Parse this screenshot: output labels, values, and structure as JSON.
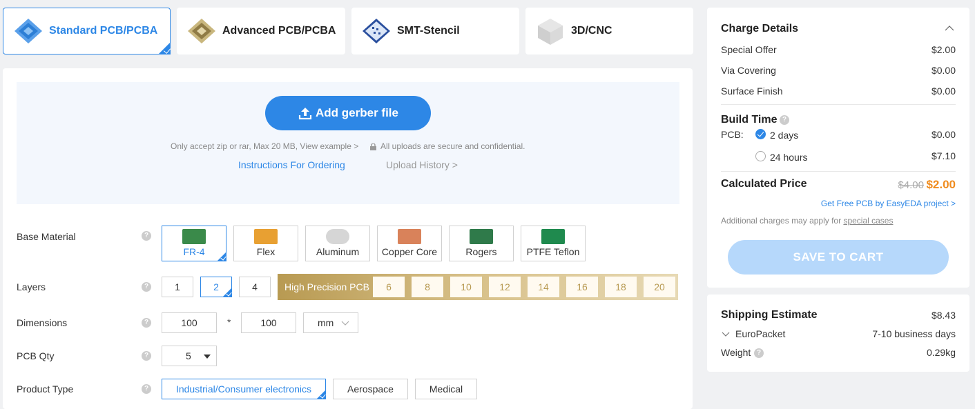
{
  "tabs": [
    {
      "label": "Standard PCB/PCBA",
      "active": true
    },
    {
      "label": "Advanced PCB/PCBA",
      "active": false
    },
    {
      "label": "SMT-Stencil",
      "active": false
    },
    {
      "label": "3D/CNC",
      "active": false
    }
  ],
  "upload": {
    "button_label": "Add gerber file",
    "accept_note": "Only accept zip or rar, Max 20 MB, View example >",
    "secure_note": "All uploads are secure and confidential.",
    "instructions_link": "Instructions For Ordering",
    "history_link": "Upload History >"
  },
  "form": {
    "base_material": {
      "label": "Base Material",
      "options": [
        "FR-4",
        "Flex",
        "Aluminum",
        "Copper Core",
        "Rogers",
        "PTFE Teflon"
      ],
      "selected": "FR-4"
    },
    "layers": {
      "label": "Layers",
      "options": [
        "1",
        "2",
        "4"
      ],
      "selected": "2",
      "high_precision_label": "High Precision PCB",
      "high_precision_options": [
        "6",
        "8",
        "10",
        "12",
        "14",
        "16",
        "18",
        "20"
      ]
    },
    "dimensions": {
      "label": "Dimensions",
      "width": "100",
      "times": "*",
      "height": "100",
      "unit": "mm"
    },
    "qty": {
      "label": "PCB Qty",
      "value": "5"
    },
    "product_type": {
      "label": "Product Type",
      "options": [
        "Industrial/Consumer electronics",
        "Aerospace",
        "Medical"
      ],
      "selected": "Industrial/Consumer electronics"
    },
    "help_glyph": "?"
  },
  "charges": {
    "title": "Charge Details",
    "items": [
      {
        "label": "Special Offer",
        "value": "$2.00"
      },
      {
        "label": "Via Covering",
        "value": "$0.00"
      },
      {
        "label": "Surface Finish",
        "value": "$0.00"
      }
    ],
    "build_time": {
      "title": "Build Time",
      "pcb_label": "PCB:",
      "options": [
        {
          "label": "2 days",
          "value": "$0.00",
          "selected": true
        },
        {
          "label": "24 hours",
          "value": "$7.10",
          "selected": false
        }
      ]
    },
    "calculated": {
      "label": "Calculated Price",
      "old_price": "$4.00",
      "price": "$2.00"
    },
    "easyeda_link": "Get Free PCB by EasyEDA project >",
    "additional_note": "Additional charges may apply for",
    "special_cases_link": "special cases",
    "save_button": "SAVE TO CART"
  },
  "shipping": {
    "title": "Shipping Estimate",
    "price": "$8.43",
    "method": "EuroPacket",
    "days": "7-10 business days",
    "weight_label": "Weight",
    "weight": "0.29kg"
  },
  "colors": {
    "accent": "#2d87e6",
    "price_orange": "#f08c1e",
    "gold": "#b89a52",
    "save_disabled": "#b6d8fb"
  }
}
